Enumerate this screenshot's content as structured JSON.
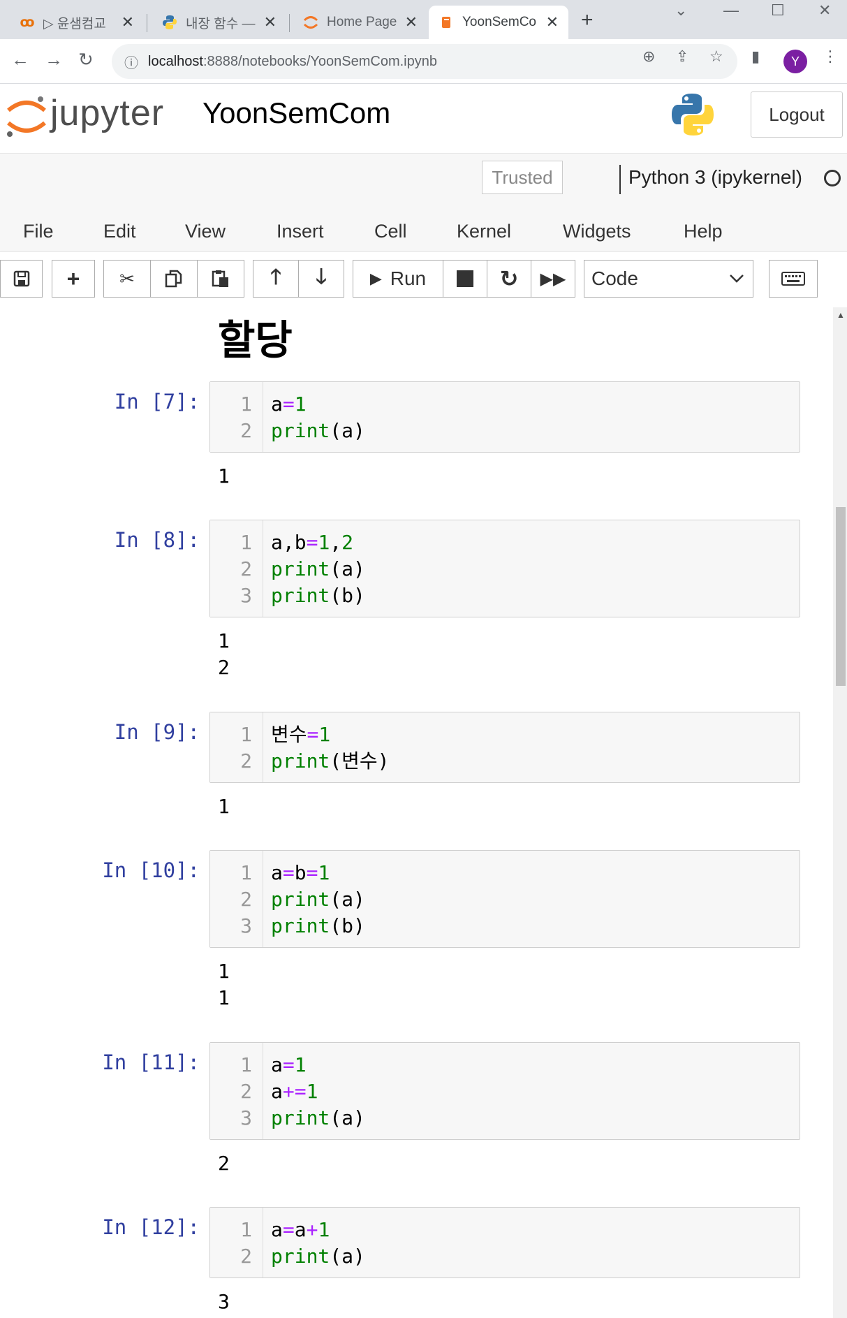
{
  "browser": {
    "tabs": [
      {
        "title": "▷ 윤샘컴교",
        "active": false
      },
      {
        "title": "내장 함수 —",
        "active": false
      },
      {
        "title": "Home Page",
        "active": false
      },
      {
        "title": "YoonSemCo",
        "active": true
      }
    ],
    "url_host": "localhost",
    "url_rest": ":8888/notebooks/YoonSemCom.ipynb",
    "profile_initial": "Y"
  },
  "header": {
    "logo_text": "jupyter",
    "notebook_name": "YoonSemCom",
    "logout_label": "Logout"
  },
  "status": {
    "trusted_label": "Trusted",
    "kernel_name": "Python 3 (ipykernel)"
  },
  "menu": [
    "File",
    "Edit",
    "View",
    "Insert",
    "Cell",
    "Kernel",
    "Widgets",
    "Help"
  ],
  "toolbar": {
    "run_label": "Run",
    "cell_type": "Code"
  },
  "notebook": {
    "heading": "할당",
    "cells": [
      {
        "prompt": "In [7]:",
        "lines": [
          "a=1",
          "print(a)"
        ],
        "output": [
          "1"
        ]
      },
      {
        "prompt": "In [8]:",
        "lines": [
          "a,b=1,2",
          "print(a)",
          "print(b)"
        ],
        "output": [
          "1",
          "2"
        ]
      },
      {
        "prompt": "In [9]:",
        "lines": [
          "변수=1",
          "print(변수)"
        ],
        "output": [
          "1"
        ]
      },
      {
        "prompt": "In [10]:",
        "lines": [
          "a=b=1",
          "print(a)",
          "print(b)"
        ],
        "output": [
          "1",
          "1"
        ]
      },
      {
        "prompt": "In [11]:",
        "lines": [
          "a=1",
          "a+=1",
          "print(a)"
        ],
        "output": [
          "2"
        ]
      },
      {
        "prompt": "In [12]:",
        "lines": [
          "a=a+1",
          "print(a)"
        ],
        "output": [
          "3"
        ]
      }
    ]
  },
  "colors": {
    "prompt": "#303f9f",
    "keyword": "#008000",
    "operator": "#aa22ff",
    "jupyter_orange": "#f37726",
    "avatar": "#7b1fa2"
  }
}
